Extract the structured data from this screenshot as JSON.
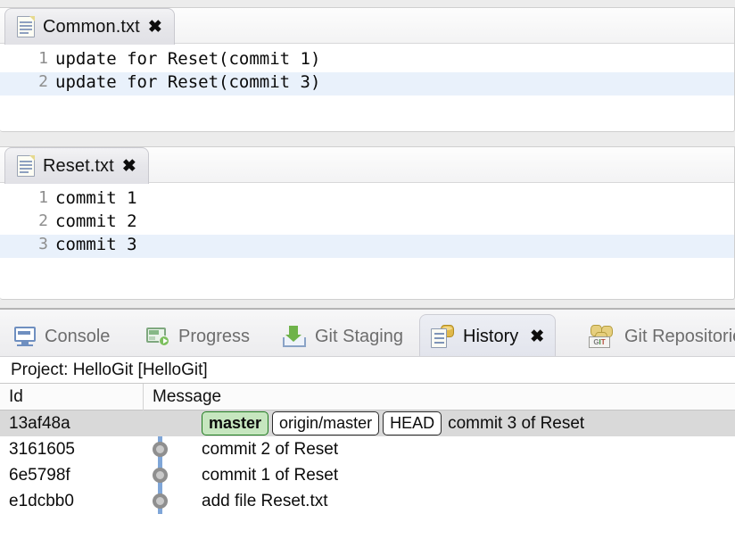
{
  "editors": [
    {
      "tab": {
        "title": "Common.txt",
        "close": "✖",
        "icon": "text-file-icon"
      },
      "lines": [
        {
          "no": "1",
          "text": "update for Reset(commit 1)",
          "highlight": false
        },
        {
          "no": "2",
          "text": "update for Reset(commit 3)",
          "highlight": true
        }
      ]
    },
    {
      "tab": {
        "title": "Reset.txt",
        "close": "✖",
        "icon": "text-file-icon"
      },
      "lines": [
        {
          "no": "1",
          "text": "commit 1",
          "highlight": false
        },
        {
          "no": "2",
          "text": "commit 2",
          "highlight": false
        },
        {
          "no": "3",
          "text": "commit 3",
          "highlight": true
        }
      ]
    }
  ],
  "bottom_view": {
    "tabs": [
      {
        "label": "Console",
        "icon": "console-icon",
        "active": false
      },
      {
        "label": "Progress",
        "icon": "progress-icon",
        "active": false
      },
      {
        "label": "Git Staging",
        "icon": "git-staging-icon",
        "active": false
      },
      {
        "label": "History",
        "icon": "history-icon",
        "active": true,
        "close": "✖"
      },
      {
        "label": "Git Repositories",
        "icon": "git-repositories-icon",
        "active": false
      }
    ],
    "project_line": "Project: HelloGit [HelloGit]",
    "table": {
      "columns": [
        "Id",
        "Message"
      ],
      "rows": [
        {
          "id": "13af48a",
          "message": "commit 3 of Reset",
          "selected": true,
          "badges": [
            {
              "label": "master",
              "type": "current-branch"
            },
            {
              "label": "origin/master",
              "type": "remote-branch"
            },
            {
              "label": "HEAD",
              "type": "head"
            }
          ]
        },
        {
          "id": "3161605",
          "message": "commit 2 of Reset",
          "selected": false,
          "badges": []
        },
        {
          "id": "6e5798f",
          "message": "commit 1 of Reset",
          "selected": false,
          "badges": []
        },
        {
          "id": "e1dcbb0",
          "message": "add file Reset.txt",
          "selected": false,
          "badges": []
        }
      ]
    }
  },
  "colors": {
    "selection_row": "#d9d9d9",
    "line_highlight": "#e9f1fb",
    "current_branch_bg": "#c6e6bf",
    "current_branch_border": "#1f7a1f",
    "graph_lane": "#7fa6d8",
    "graph_node": "#8f8f8f"
  }
}
